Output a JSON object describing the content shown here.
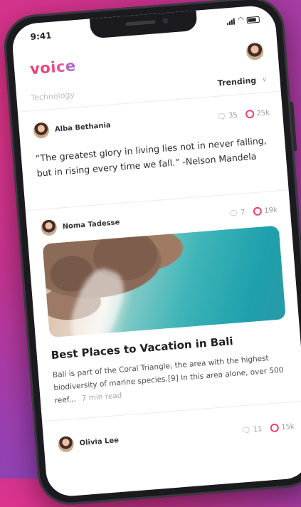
{
  "status": {
    "time": "9:41"
  },
  "app": {
    "name": "voice"
  },
  "filters": {
    "category": "Technology",
    "sort": "Trending"
  },
  "posts": [
    {
      "author": "Alba Bethania",
      "comments": "35",
      "likes": "25k",
      "quote": "“The greatest glory in living lies not in never falling, but in rising every time we fall.” -Nelson Mandela"
    },
    {
      "author": "Noma Tadesse",
      "comments": "7",
      "likes": "19k",
      "title": "Best Places to Vacation in Bali",
      "excerpt": "Bali is part of the Coral Triangle, the area with the highest biodiversity of marine species.[9] In this area alone, over 500 reef...",
      "read_time": "7 min read"
    },
    {
      "author": "Olivia Lee",
      "comments": "11",
      "likes": "15k"
    }
  ],
  "colors": {
    "brand": "#ee3d73",
    "accent": "#9c6fe0"
  }
}
